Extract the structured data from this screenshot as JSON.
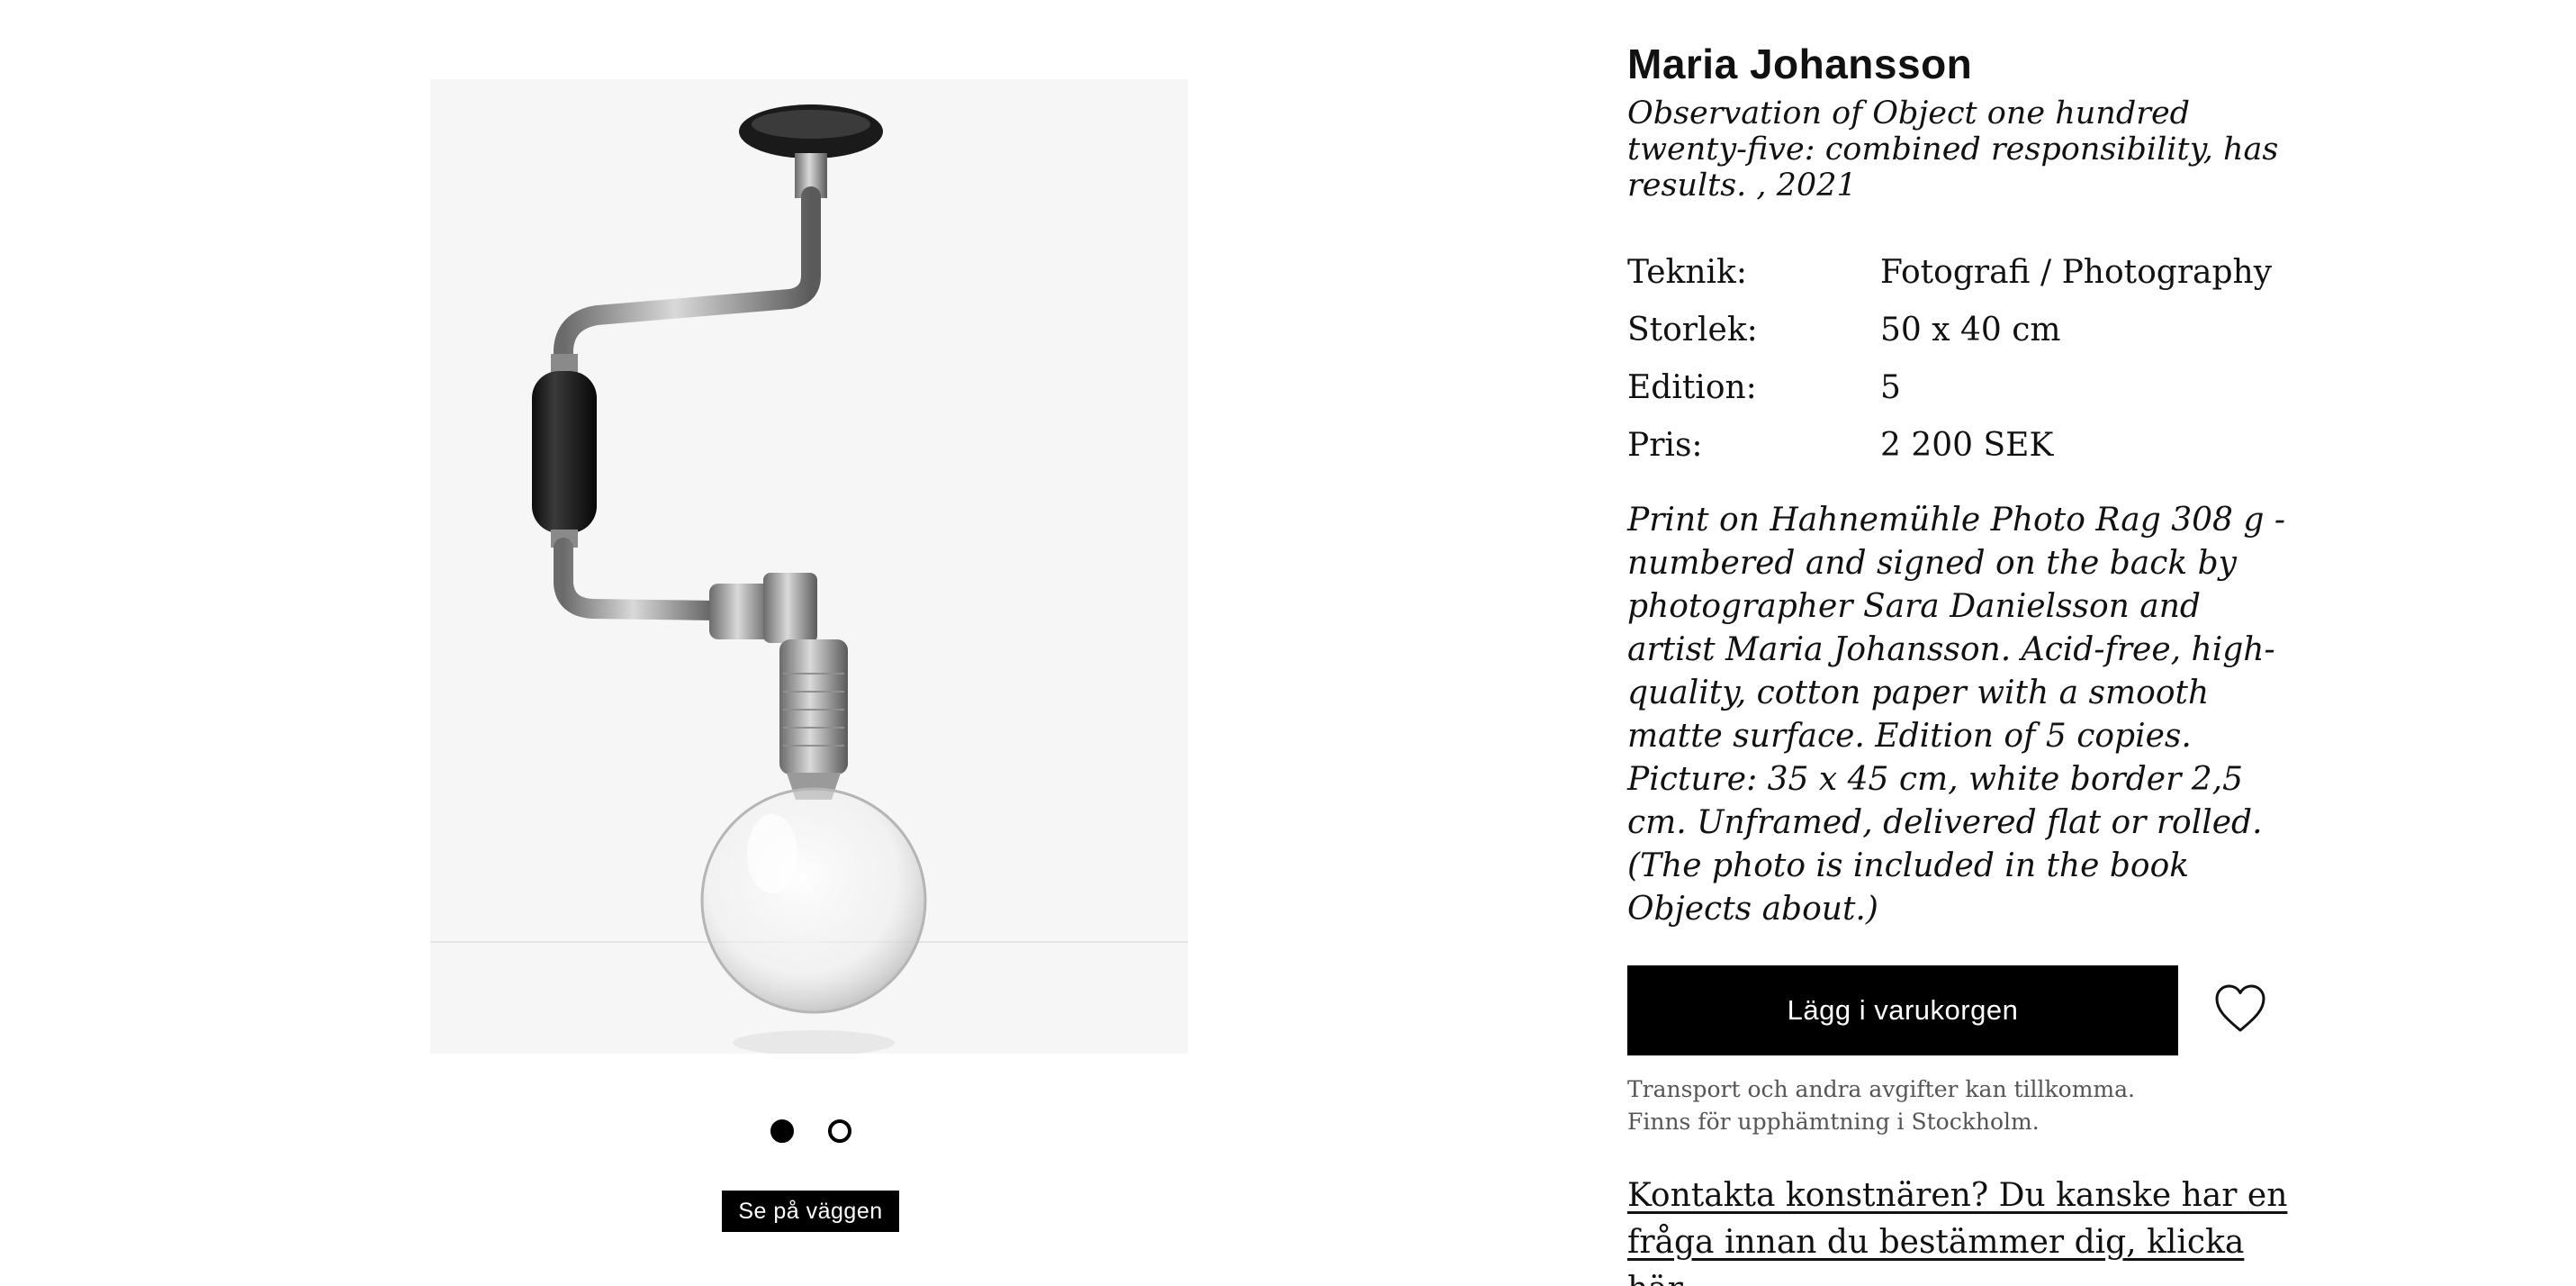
{
  "product": {
    "artist": "Maria Johansson",
    "title": "Observation of Object one hundred twenty-five: combined responsibility, has results. , 2021",
    "specs": [
      {
        "key": "Teknik:",
        "value": "Fotografi / Photography"
      },
      {
        "key": "Storlek:",
        "value": "50 x 40 cm"
      },
      {
        "key": "Edition:",
        "value": "5"
      },
      {
        "key": "Pris:",
        "value": "2 200 SEK"
      }
    ],
    "description": "Print on Hahnemühle Photo Rag 308 g - numbered and signed on the back by photographer Sara Danielsson and artist Maria Johansson. Acid-free, high-quality, cotton paper with a smooth matte surface. Edition of 5 copies. Picture: 35 x 45 cm, white border 2,5 cm. Unframed, delivered flat or rolled. (The photo is included in the book Objects about.)"
  },
  "gallery": {
    "image_subject": "brace-drill-with-glass-sphere",
    "dot_count": 2,
    "active_index": 0,
    "wall_button_label": "Se på väggen"
  },
  "cart": {
    "add_label": "Lägg i varukorgen",
    "favorite_icon": "heart-icon"
  },
  "notes": {
    "line1": "Transport och andra avgifter kan tillkomma.",
    "line2": "Finns för upphämtning i Stockholm."
  },
  "contact": {
    "label": "Kontakta konstnären? Du kanske har en fråga innan du bestämmer dig, klicka här."
  },
  "colors": {
    "button_bg": "#000000",
    "button_text": "#ffffff",
    "image_bg": "#f6f6f6"
  }
}
